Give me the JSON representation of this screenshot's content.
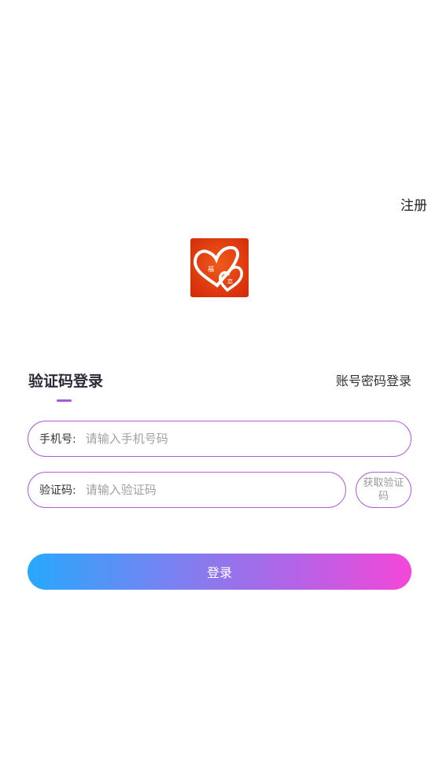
{
  "header": {
    "register_label": "注册"
  },
  "logo": {
    "icon": "double-heart-logo",
    "text_left": "福",
    "text_right": "恋",
    "colors": {
      "background": "#e8380f",
      "heart": "#ffffff"
    }
  },
  "tabs": {
    "active_label": "验证码登录",
    "other_label": "账号密码登录",
    "indicator_color": "#a855e6"
  },
  "form": {
    "phone": {
      "label": "手机号:",
      "placeholder": "请输入手机号码",
      "value": ""
    },
    "code": {
      "label": "验证码:",
      "placeholder": "请输入验证码",
      "value": ""
    },
    "get_code_label": "获取验证码",
    "border_color": "#b35ad8"
  },
  "login": {
    "label": "登录",
    "gradient_start": "#28a8fd",
    "gradient_end": "#f447d8"
  }
}
